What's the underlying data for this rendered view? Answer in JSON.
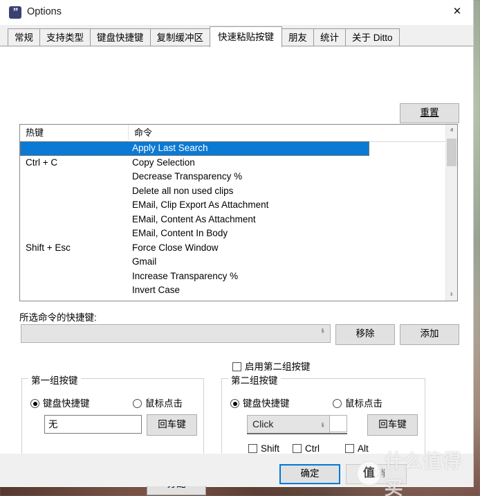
{
  "window": {
    "title": "Options",
    "icon": "ditto-quote-icon",
    "close_label": "✕"
  },
  "tabs": [
    {
      "label": "常规",
      "active": false
    },
    {
      "label": "支持类型",
      "active": false
    },
    {
      "label": "键盘快捷键",
      "active": false
    },
    {
      "label": "复制缓冲区",
      "active": false
    },
    {
      "label": "快速粘贴按键",
      "active": true
    },
    {
      "label": "朋友",
      "active": false
    },
    {
      "label": "统计",
      "active": false
    },
    {
      "label": "关于 Ditto",
      "active": false
    }
  ],
  "toolbar": {
    "reset_label": "重置"
  },
  "list": {
    "columns": [
      "热键",
      "命令"
    ],
    "rows": [
      {
        "hotkey": "",
        "command": "Apply Last Search",
        "selected": true
      },
      {
        "hotkey": "Ctrl + C",
        "command": "Copy Selection",
        "selected": false
      },
      {
        "hotkey": "",
        "command": "Decrease Transparency %",
        "selected": false
      },
      {
        "hotkey": "",
        "command": "Delete all non used clips",
        "selected": false
      },
      {
        "hotkey": "",
        "command": "EMail, Clip Export As Attachment",
        "selected": false
      },
      {
        "hotkey": "",
        "command": "EMail, Content As Attachment",
        "selected": false
      },
      {
        "hotkey": "",
        "command": "EMail, Content In Body",
        "selected": false
      },
      {
        "hotkey": "Shift + Esc",
        "command": "Force Close Window",
        "selected": false
      },
      {
        "hotkey": "",
        "command": "Gmail",
        "selected": false
      },
      {
        "hotkey": "",
        "command": "Increase Transparency %",
        "selected": false
      },
      {
        "hotkey": "",
        "command": "Invert Case",
        "selected": false
      }
    ],
    "scrollbar": {
      "up_arrow": "ⱏ",
      "down_arrow": "ⱛ"
    }
  },
  "shortcut_section": {
    "label": "所选命令的快捷键:",
    "combo_value": "",
    "combo_chevron": "ⱛ",
    "remove_label": "移除",
    "add_label": "添加"
  },
  "enable_second": {
    "label": "启用第二组按键",
    "checked": false
  },
  "group1": {
    "title": "第一组按键",
    "radio_keyboard": "键盘快捷键",
    "radio_mouse": "鼠标点击",
    "selected": "keyboard",
    "key_value": "无",
    "enter_label": "回车键"
  },
  "group2": {
    "title": "第二组按键",
    "radio_keyboard": "键盘快捷键",
    "radio_mouse": "鼠标点击",
    "selected": "keyboard",
    "click_value": "Click",
    "click_chevron": "ⱛ",
    "enter_label": "回车键",
    "modifiers": [
      {
        "label": "Shift",
        "checked": false
      },
      {
        "label": "Ctrl",
        "checked": false
      },
      {
        "label": "Alt",
        "checked": false
      }
    ]
  },
  "assign": {
    "label": "分配"
  },
  "footer": {
    "ok_label": "确定",
    "cancel_label": "取消"
  },
  "watermark": {
    "logo": "值",
    "text": "什么值得买"
  }
}
